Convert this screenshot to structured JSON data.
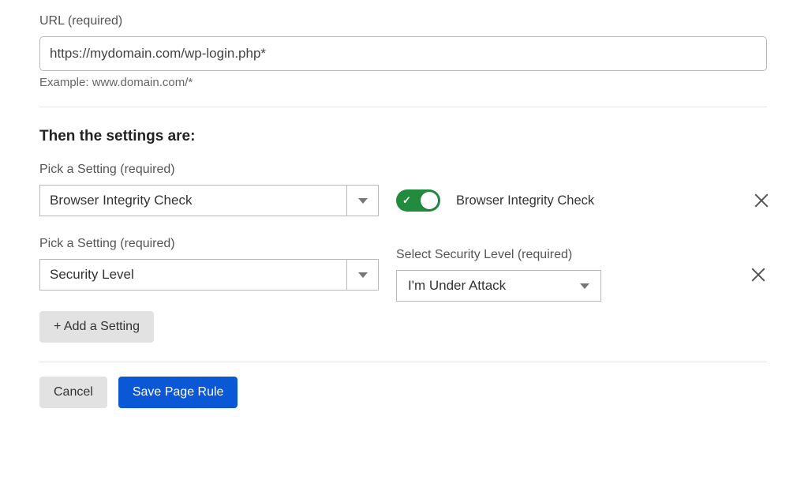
{
  "url_field": {
    "label": "URL (required)",
    "value": "https://mydomain.com/wp-login.php*",
    "hint": "Example: www.domain.com/*"
  },
  "section_title": "Then the settings are:",
  "settings": [
    {
      "picker_label": "Pick a Setting (required)",
      "picker_value": "Browser Integrity Check",
      "secondary_label": "",
      "toggle_label": "Browser Integrity Check",
      "toggle_on": true
    },
    {
      "picker_label": "Pick a Setting (required)",
      "picker_value": "Security Level",
      "secondary_label": "Select Security Level (required)",
      "secondary_value": "I'm Under Attack"
    }
  ],
  "add_setting_label": "+ Add a Setting",
  "cancel_label": "Cancel",
  "save_label": "Save Page Rule",
  "colors": {
    "toggle_on": "#228B3E",
    "primary": "#0a58d6"
  }
}
